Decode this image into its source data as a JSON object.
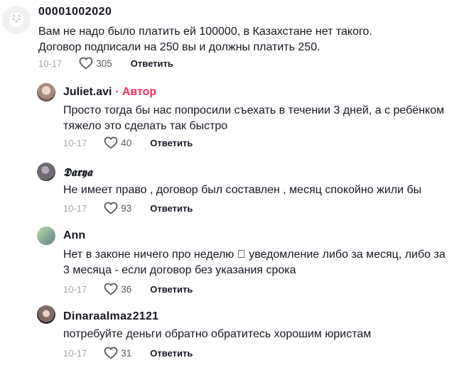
{
  "comments": [
    {
      "username": "00001002020",
      "text": "Вам не надо было платить ей 100000, в Казахстане нет такого. Договор подписали на 250 вы и должны платить 250.",
      "date": "10-17",
      "likes": "305",
      "reply_label": "Ответить",
      "avatar_color": "#f1f1f2"
    },
    {
      "username": "Juliet.avi",
      "author_dot": "·",
      "author_label": "Автор",
      "text": "Просто тогда бы нас попросили съехать в течении 3 дней, а с ребёнком тяжело это сделать так быстро",
      "date": "10-17",
      "likes": "40",
      "reply_label": "Ответить",
      "avatar_color": "#a88a7c"
    },
    {
      "username": "𝕯𝖆𝖗𝖞𝖆",
      "text": "Не имеет право , договор был составлен , месяц спокойно жили бы",
      "date": "10-17",
      "likes": "93",
      "reply_label": "Ответить",
      "avatar_color": "#6f6a73"
    },
    {
      "username": "Ann",
      "text": "Нет в законе ничего про неделю 􀀀 уведомление либо за месяц, либо за 3 месяца - если договор без указания срока",
      "date": "10-17",
      "likes": "36",
      "reply_label": "Ответить",
      "avatar_color": "#8fb39a"
    },
    {
      "username": "Dinaraalmaz2121",
      "text": "потребуйте деньги обратно обратитесь хорошим юристам",
      "date": "10-17",
      "likes": "31",
      "reply_label": "Ответить",
      "avatar_color": "#7d6b66"
    }
  ]
}
